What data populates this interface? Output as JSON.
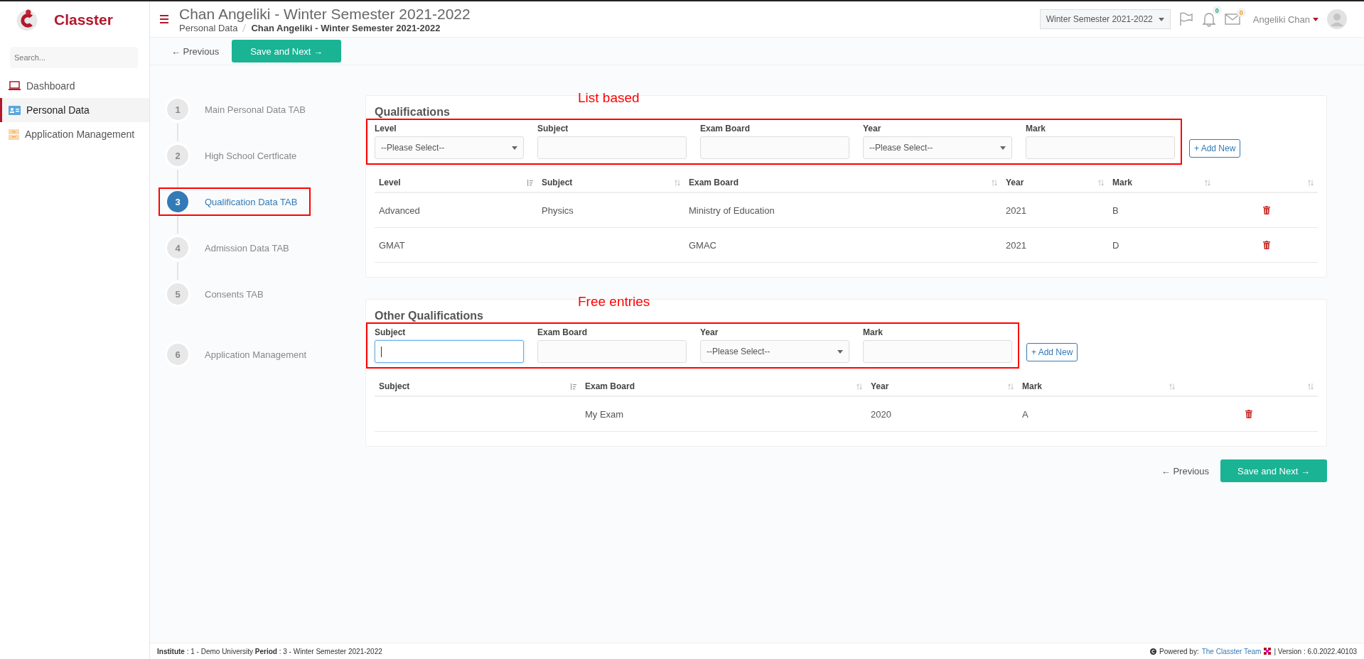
{
  "brand": {
    "name": "Classter"
  },
  "sidebar": {
    "search_placeholder": "Search...",
    "items": [
      {
        "label": "Dashboard",
        "selected": false
      },
      {
        "label": "Personal Data",
        "selected": true
      },
      {
        "label": "Application Management",
        "selected": false
      }
    ]
  },
  "header": {
    "title": "Chan Angeliki - Winter Semester 2021-2022",
    "breadcrumb": [
      "Personal Data",
      "Chan Angeliki - Winter Semester 2021-2022"
    ],
    "period_select": "Winter Semester 2021-2022",
    "notifications_count": "0",
    "messages_count": "0",
    "user": "Angeliki Chan"
  },
  "toolbar": {
    "previous": "← Previous",
    "save_next": "Save and Next →"
  },
  "steps": [
    {
      "number": "1",
      "label": "Main Personal Data TAB",
      "selected": false,
      "highlighted": false
    },
    {
      "number": "2",
      "label": "High School Certficate",
      "selected": false,
      "highlighted": false
    },
    {
      "number": "3",
      "label": "Qualification Data TAB",
      "selected": true,
      "highlighted": true
    },
    {
      "number": "4",
      "label": "Admission Data TAB",
      "selected": false,
      "highlighted": false
    },
    {
      "number": "5",
      "label": "Consents TAB",
      "selected": false,
      "highlighted": false
    },
    {
      "number": "6",
      "label": "Application Management",
      "selected": false,
      "highlighted": false
    }
  ],
  "sections": [
    {
      "title": "Qualifications",
      "annotation": "List based",
      "add_button": "+ Add New",
      "fields": [
        {
          "label": "Level",
          "kind": "select",
          "value": "--Please Select--"
        },
        {
          "label": "Subject",
          "kind": "text",
          "focused": false
        },
        {
          "label": "Exam Board",
          "kind": "text",
          "focused": false
        },
        {
          "label": "Year",
          "kind": "select",
          "value": "--Please Select--"
        },
        {
          "label": "Mark",
          "kind": "text",
          "focused": false
        }
      ],
      "columns": [
        {
          "label": "Level",
          "sorted": true
        },
        {
          "label": "Subject",
          "sorted": false
        },
        {
          "label": "Exam Board",
          "sorted": false
        },
        {
          "label": "Year",
          "sorted": false
        },
        {
          "label": "Mark",
          "sorted": false
        }
      ],
      "rows": [
        [
          "Advanced",
          "Physics",
          "Ministry of Education",
          "2021",
          "B"
        ],
        [
          "GMAT",
          "",
          "GMAC",
          "2021",
          "D"
        ]
      ]
    },
    {
      "title": "Other Qualifications",
      "annotation": "Free entries",
      "add_button": "+ Add New",
      "fields": [
        {
          "label": "Subject",
          "kind": "text",
          "focused": true
        },
        {
          "label": "Exam Board",
          "kind": "text",
          "focused": false
        },
        {
          "label": "Year",
          "kind": "select",
          "value": "--Please Select--"
        },
        {
          "label": "Mark",
          "kind": "text",
          "focused": false
        }
      ],
      "columns": [
        {
          "label": "Subject",
          "sorted": true
        },
        {
          "label": "Exam Board",
          "sorted": false
        },
        {
          "label": "Year",
          "sorted": false
        },
        {
          "label": "Mark",
          "sorted": false
        }
      ],
      "rows": [
        [
          "",
          "My Exam",
          "2020",
          "A"
        ]
      ]
    }
  ],
  "bottom_nav": {
    "previous": "← Previous",
    "save_next": "Save and Next →"
  },
  "footer": {
    "info": "**Institute** : 1 - Demo University **Period** : 3 - Winter Semester 2021-2022",
    "powered_by": "Powered by:",
    "team_link": "The Classter Team",
    "version": "| Version : 6.0.2022.40103"
  }
}
